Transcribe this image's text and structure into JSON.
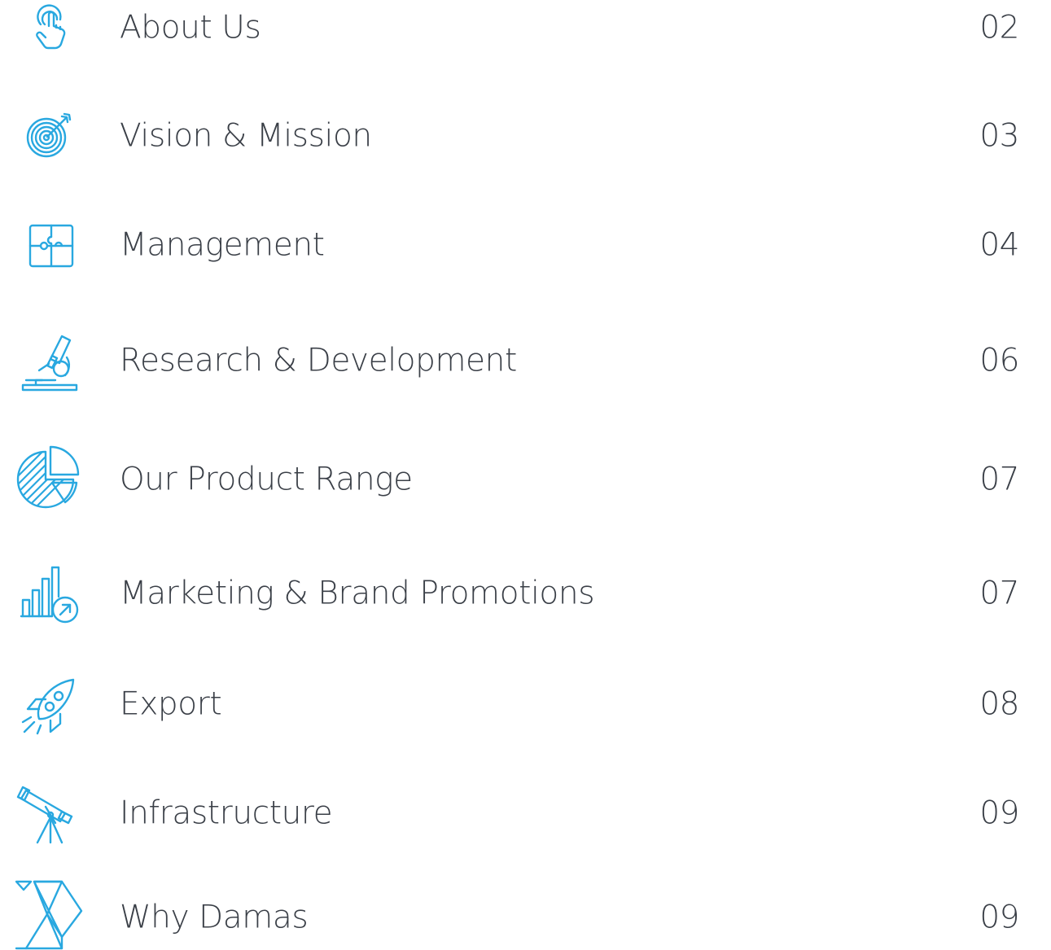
{
  "accent_color": "#29a8e0",
  "text_color": "#3a3f47",
  "items": [
    {
      "label": "About Us",
      "page": "02",
      "icon": "touch-icon"
    },
    {
      "label": "Vision & Mission",
      "page": "03",
      "icon": "target-icon"
    },
    {
      "label": "Management",
      "page": "04",
      "icon": "puzzle-icon"
    },
    {
      "label": "Research & Development",
      "page": "06",
      "icon": "microscope-icon"
    },
    {
      "label": "Our Product Range",
      "page": "07",
      "icon": "pie-chart-icon"
    },
    {
      "label": "Marketing & Brand Promotions",
      "page": "07",
      "icon": "growth-chart-icon"
    },
    {
      "label": "Export",
      "page": "08",
      "icon": "rocket-icon"
    },
    {
      "label": "Infrastructure",
      "page": "09",
      "icon": "telescope-icon"
    },
    {
      "label": "Why Damas",
      "page": "09",
      "icon": "damas-logo-icon"
    }
  ]
}
